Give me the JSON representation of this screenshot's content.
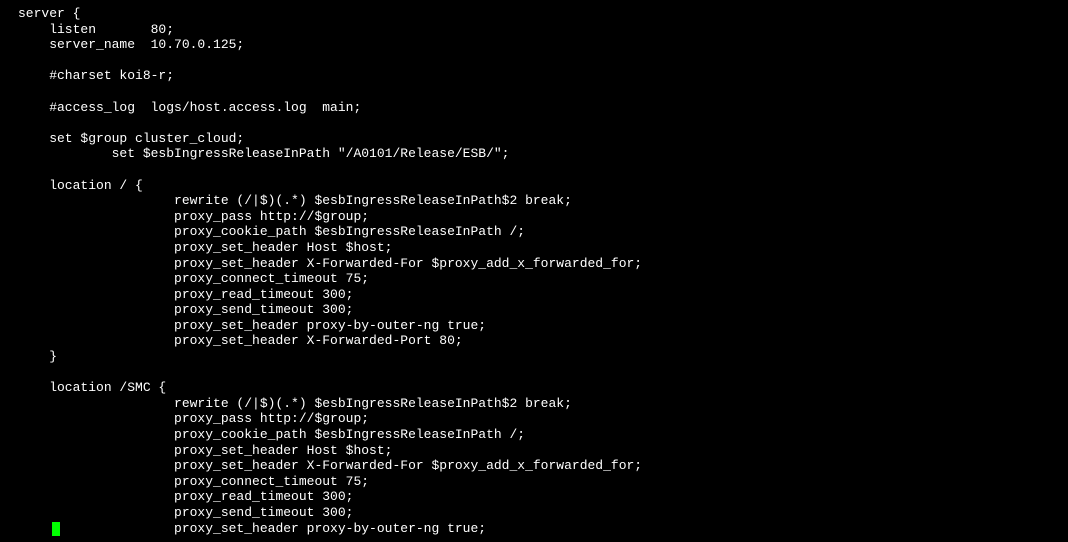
{
  "terminal": {
    "lines": [
      "server {",
      "    listen       80;",
      "    server_name  10.70.0.125;",
      "",
      "    #charset koi8-r;",
      "",
      "    #access_log  logs/host.access.log  main;",
      "",
      "    set $group cluster_cloud;",
      "            set $esbIngressReleaseInPath \"/A0101/Release/ESB/\";",
      "",
      "    location / {",
      "                    rewrite (/|$)(.*) $esbIngressReleaseInPath$2 break;",
      "                    proxy_pass http://$group;",
      "                    proxy_cookie_path $esbIngressReleaseInPath /;",
      "                    proxy_set_header Host $host;",
      "                    proxy_set_header X-Forwarded-For $proxy_add_x_forwarded_for;",
      "                    proxy_connect_timeout 75;",
      "                    proxy_read_timeout 300;",
      "                    proxy_send_timeout 300;",
      "                    proxy_set_header proxy-by-outer-ng true;",
      "                    proxy_set_header X-Forwarded-Port 80;",
      "    }",
      "",
      "    location /SMC {",
      "                    rewrite (/|$)(.*) $esbIngressReleaseInPath$2 break;",
      "                    proxy_pass http://$group;",
      "                    proxy_cookie_path $esbIngressReleaseInPath /;",
      "                    proxy_set_header Host $host;",
      "                    proxy_set_header X-Forwarded-For $proxy_add_x_forwarded_for;",
      "                    proxy_connect_timeout 75;",
      "                    proxy_read_timeout 300;",
      "                    proxy_send_timeout 300;",
      "                    proxy_set_header proxy-by-outer-ng true;"
    ]
  }
}
